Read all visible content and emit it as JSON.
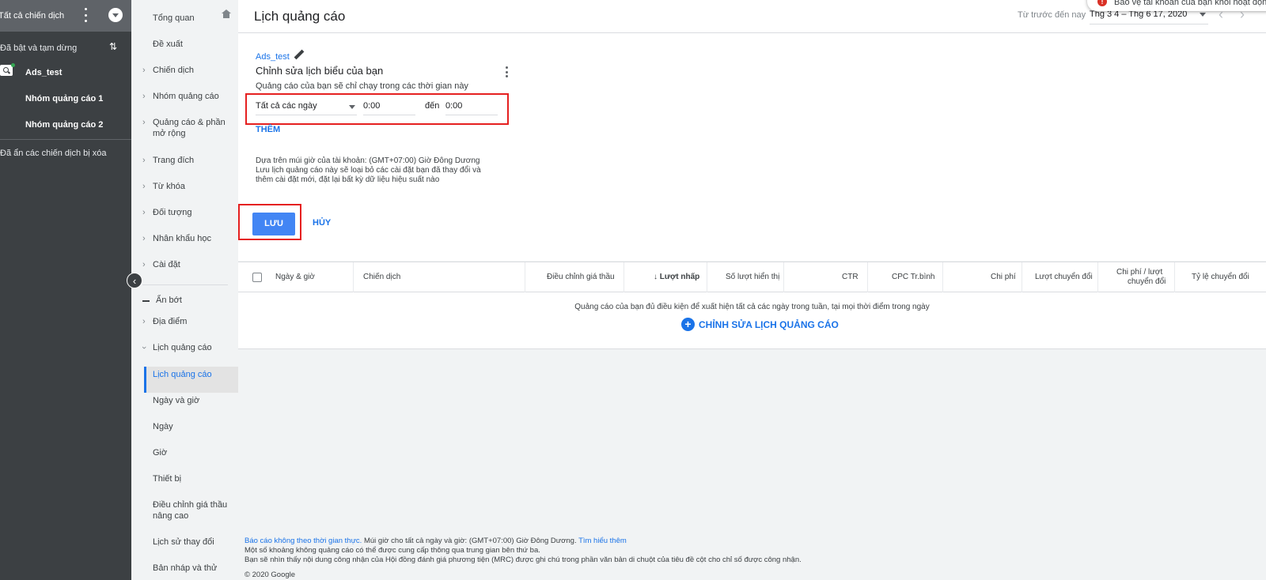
{
  "left_sidebar": {
    "all_campaigns": "Tất cả chiến dịch",
    "filter_label": "Đã bật và tạm dừng",
    "campaign": "Ads_test",
    "ad_groups": [
      "Nhóm quảng cáo 1",
      "Nhóm quảng cáo 2"
    ],
    "hidden_deleted": "Đã ẩn các chiến dịch bị xóa",
    "colors": {
      "bg": "#3c4043",
      "header": "#5f6368",
      "active_dot": "#34a853"
    }
  },
  "nav": {
    "items": [
      "Tổng quan",
      "Đề xuất",
      "Chiến dịch",
      "Nhóm quảng cáo",
      "Quảng cáo & phần",
      "mở rộng",
      "Trang đích",
      "Từ khóa",
      "Đối tượng",
      "Nhân khẩu học",
      "Cài đặt"
    ],
    "less": "Ẩn bớt",
    "more_items": [
      "Địa điểm",
      "Lịch quảng cáo"
    ],
    "sub_items": [
      "Lịch quảng cáo",
      "Ngày và giờ",
      "Ngày",
      "Giờ",
      "Thiết bị",
      "Điều chỉnh giá thầu",
      "nâng cao",
      "Lịch sử thay đổi",
      "Bản nháp và thử"
    ],
    "selected": "Lịch quảng cáo"
  },
  "header": {
    "title": "Lịch quảng cáo",
    "date_label": "Từ trước đến nay",
    "date_range": "Thg 3 4 – Thg 6 17, 2020"
  },
  "toast": {
    "text": "Bảo vệ tài khoản của bạn khỏi hoạt động trái phép"
  },
  "editor": {
    "campaign_link": "Ads_test",
    "heading": "Chỉnh sửa lịch biểu của bạn",
    "subtitle": "Quảng cáo của bạn sẽ chỉ chạy trong các thời gian này",
    "day_select": "Tất cả các ngày",
    "start_time": "0:00",
    "to_label": "đến",
    "end_time": "0:00",
    "add": "THÊM",
    "note_lines": [
      "Dựa trên múi giờ của tài khoản: (GMT+07:00) Giờ Đông Dương",
      "Lưu lịch quảng cáo này sẽ loại bỏ các cài đặt bạn đã thay đổi và",
      "thêm cài đặt mới, đặt lại bất kỳ dữ liệu hiệu suất nào"
    ],
    "save": "LƯU",
    "cancel": "HỦY",
    "highlight_color": "#e52020",
    "primary_color": "#4285f4"
  },
  "table": {
    "columns": [
      "Ngày & giờ",
      "Chiến dịch",
      "Điều chỉnh giá thầu",
      "↓ Lượt nhấp",
      "Số lượt hiển thị",
      "CTR",
      "CPC Tr.bình",
      "Chi phí",
      "Lượt chuyển đổi",
      "Chi phí / lượt",
      "chuyển đổi",
      "Tỷ lệ chuyển đổi"
    ],
    "empty_message": "Quảng cáo của bạn đủ điều kiện để xuất hiện tất cả các ngày trong tuần, tại mọi thời điểm trong ngày",
    "edit_link": "CHỈNH SỬA LỊCH QUẢNG CÁO"
  },
  "footer": {
    "line1_link": "Báo cáo không theo thời gian thực.",
    "line1_text": " Múi giờ cho tất cả ngày và giờ: (GMT+07:00) Giờ Đông Dương. ",
    "line1_more": "Tìm hiểu thêm",
    "line2": "Một số khoảng không quảng cáo có thể được cung cấp thông qua trung gian bên thứ ba.",
    "line3": "Bạn sẽ nhìn thấy nội dung công nhận của Hội đồng đánh giá phương tiện (MRC) được ghi chú trong phần văn bản di chuột của tiêu đề cột cho chỉ số được công nhận.",
    "copyright": "© 2020 Google"
  }
}
